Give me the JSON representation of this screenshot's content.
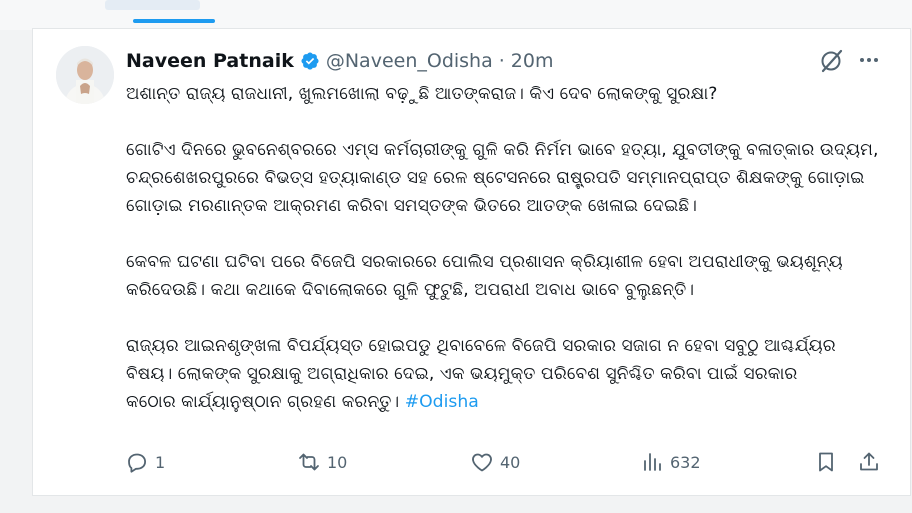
{
  "colors": {
    "accent": "#1d9bf0",
    "text": "#0f1419",
    "secondary": "#536471",
    "background": "#ffffff"
  },
  "tweet": {
    "author_name": "Naveen Patnaik",
    "verified": true,
    "handle": "@Naveen_Odisha",
    "separator": "·",
    "time": "20m",
    "paragraphs": [
      [
        "ଅଶାନ୍ତ ରାଜ୍ୟ ରାଜଧାନୀ, ଖୁଲମଖୋଲା ବଢ଼ୁଛି ଆତଙ୍କରାଜ। କିଏ ଦେବ ଲୋକଙ୍କୁ ସୁରକ୍ଷା?"
      ],
      [
        "ଗୋଟିଏ ଦିନରେ ଭୁବନେଶ୍ବରରେ ଏମ୍ସ କର୍ମଚାରୀଙ୍କୁ ଗୁଳି କରି ନିର୍ମମ ଭାବେ ହତ୍ୟା, ଯୁବତୀଙ୍କୁ ବଳାତ୍କାର ଉଦ୍ୟମ,",
        "ଚନ୍ଦ୍ରଶେଖରପୁରରେ ବିଭତ୍ସ ହତ୍ୟାକାଣ୍ଡ ସହ ରେଳ ଷ୍ଟେସନରେ ରାଷ୍ଟ୍ରପତି ସମ୍ମାନପ୍ରାପ୍ତ ଶିକ୍ଷକଙ୍କୁ ଗୋଡ଼ାଇ",
        "ଗୋଡ଼ାଇ ମରଣାନ୍ତକ ଆକ୍ରମଣ କରିବା ସମସ୍ତଙ୍କ ଭିତରେ ଆତଙ୍କ ଖେଳାଇ ଦେଇଛି।"
      ],
      [
        "କେବଳ ଘଟଣା ଘଟିବା ପରେ ବିଜେପି ସରକାରରେ ପୋଲିସ ପ୍ରଶାସନ କ୍ରିୟାଶୀଳ ହେବା ଅପରାଧୀଙ୍କୁ ଭୟଶୂନ୍ୟ",
        "କରିଦେଉଛି। କଥା କଥାକେ ଦିବାଲୋକରେ ଗୁଳି ଫୁଟୁଛି, ଅପରାଧୀ ଅବାଧ ଭାବେ ବୁଲୁଛନ୍ତି।"
      ],
      [
        "ରାଜ୍ୟର ଆଇନଶୃଙ୍ଖଳା ବିପର୍ଯ୍ୟସ୍ତ ହୋଇପଡୁ ଥିବାବେଳେ ବିଜେପି ସରକାର ସଜାଗ ନ ହେବା ସବୁଠୁ ଆଶ୍ଚର୍ଯ୍ୟର",
        "ବିଷୟ। ଲୋକଙ୍କ ସୁରକ୍ଷାକୁ ଅଗ୍ରାଧିକାର ଦେଇ, ଏକ ଭୟମୁକ୍ତ ପରିବେଶ ସୁନିଶ୍ଚିତ କରିବା ପାଇଁ ସରକାର",
        "କଠୋର କାର୍ଯ୍ୟାନୁଷ୍ଠାନ ଗ୍ରହଣ କରନ୍ତୁ।"
      ]
    ],
    "hashtag": "#Odisha",
    "replies": "1",
    "reposts": "10",
    "likes": "40",
    "views": "632"
  }
}
